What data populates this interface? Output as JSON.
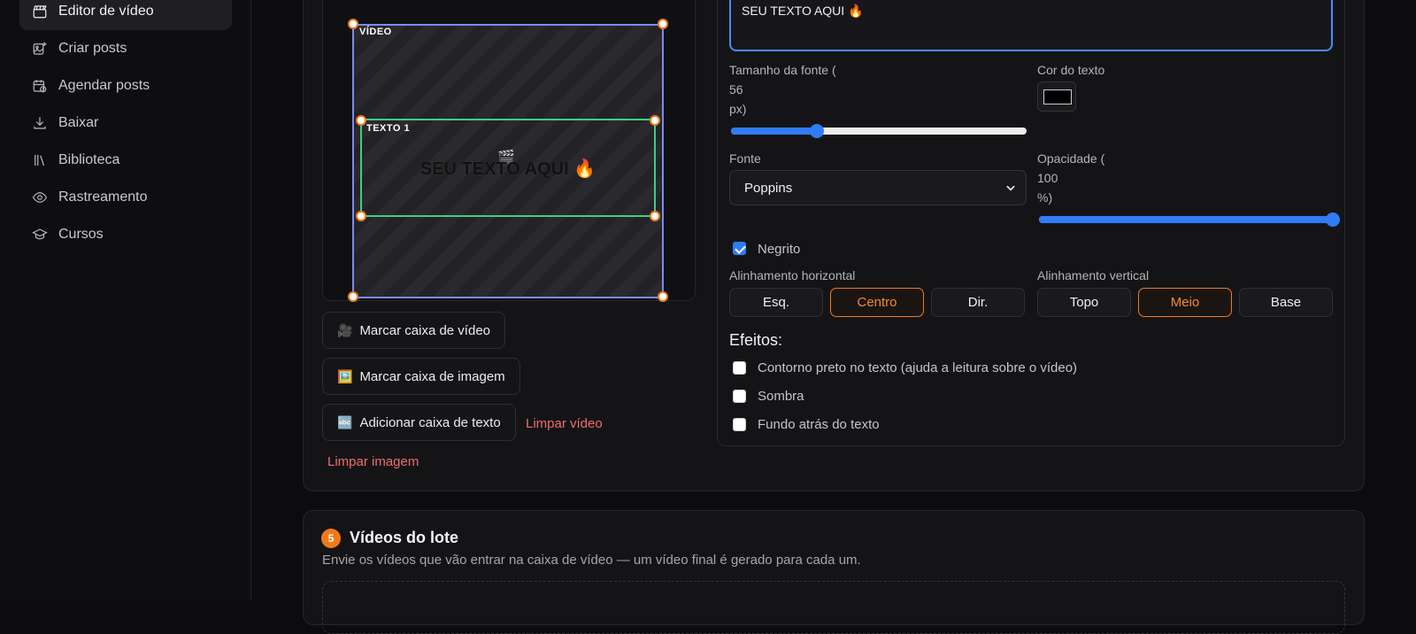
{
  "sidebar": {
    "items": [
      {
        "label": "Editor de vídeo",
        "icon": "clapperboard-icon",
        "active": true
      },
      {
        "label": "Criar posts",
        "icon": "image-plus-icon"
      },
      {
        "label": "Agendar posts",
        "icon": "calendar-clock-icon"
      },
      {
        "label": "Baixar",
        "icon": "download-icon"
      },
      {
        "label": "Biblioteca",
        "icon": "library-icon"
      },
      {
        "label": "Rastreamento",
        "icon": "eye-icon"
      },
      {
        "label": "Cursos",
        "icon": "graduation-cap-icon"
      }
    ]
  },
  "preview": {
    "video_tag": "VÍDEO",
    "text_tag": "TEXTO 1",
    "overlay_text": "SEU TEXTO AQUI 🔥",
    "clapper": "🎬"
  },
  "tools": {
    "mark_video": {
      "emoji": "🎥",
      "label": "Marcar caixa de vídeo"
    },
    "mark_image": {
      "emoji": "🖼️",
      "label": "Marcar caixa de imagem"
    },
    "add_text": {
      "emoji": "🔤",
      "label": "Adicionar caixa de texto"
    },
    "clear_video": "Limpar vídeo",
    "clear_image": "Limpar imagem"
  },
  "text_editor": {
    "value": "SEU TEXTO AQUI 🔥",
    "font_size_label_a": "Tamanho da fonte (",
    "font_size_value": "56",
    "font_size_label_b": "px)",
    "font_size_fraction": 0.29,
    "color_label": "Cor do texto",
    "color_value": "#000000",
    "font_label": "Fonte",
    "font_value": "Poppins",
    "opacity_label_a": "Opacidade (",
    "opacity_value": "100",
    "opacity_label_b": "%)",
    "opacity_fraction": 1.0,
    "bold_label": "Negrito",
    "bold_checked": true,
    "h_align_label": "Alinhamento horizontal",
    "h_align": [
      "Esq.",
      "Centro",
      "Dir."
    ],
    "h_selected": "Centro",
    "v_align_label": "Alinhamento vertical",
    "v_align": [
      "Topo",
      "Meio",
      "Base"
    ],
    "v_selected": "Meio",
    "effects_title": "Efeitos:",
    "effects": [
      {
        "label": "Contorno preto no texto (ajuda a leitura sobre o vídeo)",
        "checked": false
      },
      {
        "label": "Sombra",
        "checked": false
      },
      {
        "label": "Fundo atrás do texto",
        "checked": false
      }
    ]
  },
  "batch": {
    "step": "5",
    "title": "Vídeos do lote",
    "description": "Envie os vídeos que vão entrar na caixa de vídeo — um vídeo final é gerado para cada um."
  },
  "colors": {
    "accent_orange": "#f07a1a",
    "accent_blue": "#2f7cf6",
    "video_box": "#7a8cf0",
    "text_box": "#3ecf80",
    "danger": "#f06c6c"
  }
}
